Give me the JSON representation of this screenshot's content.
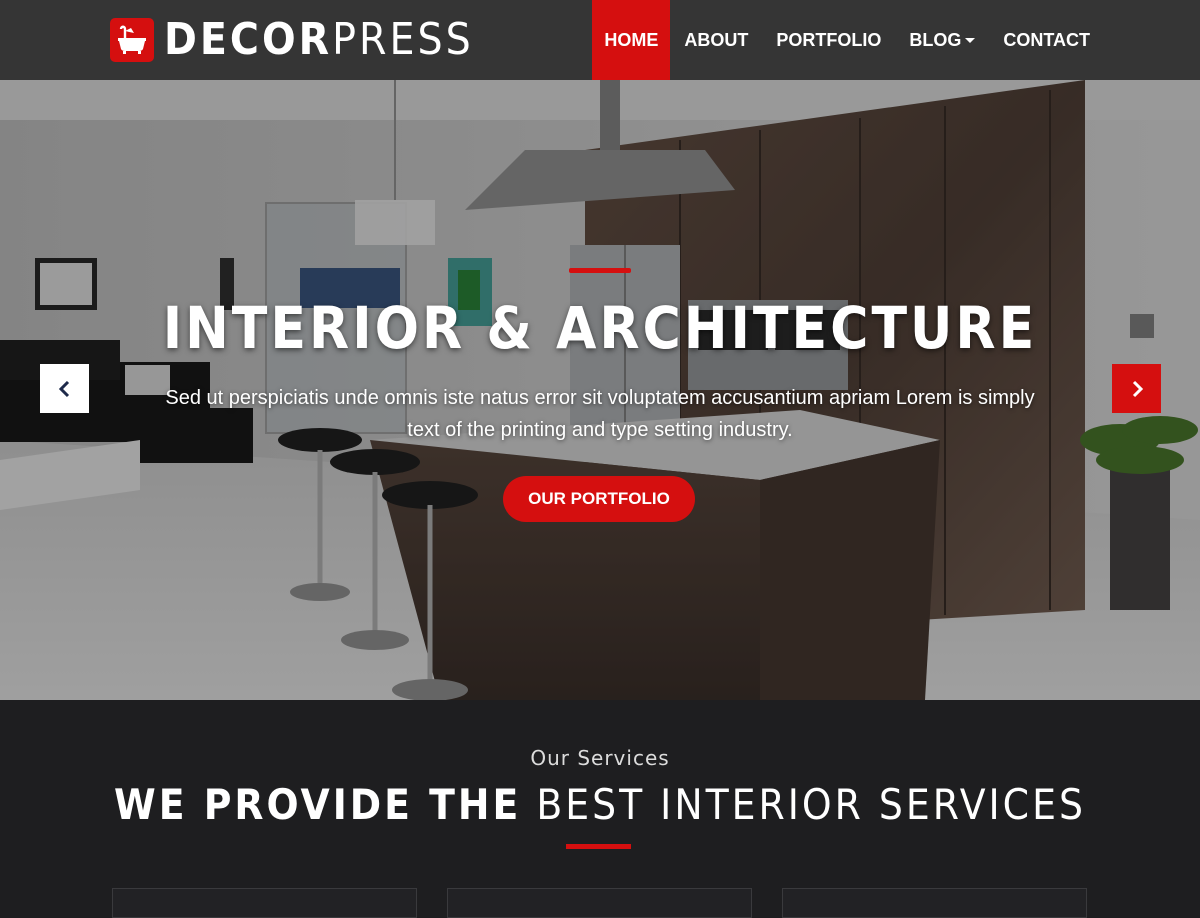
{
  "brand": {
    "name_bold": "DECOR",
    "name_light": "PRESS",
    "logo_icon": "bathtub-icon",
    "accent": "#d50f0f"
  },
  "nav": {
    "items": [
      {
        "label": "HOME",
        "active": true
      },
      {
        "label": "ABOUT"
      },
      {
        "label": "PORTFOLIO"
      },
      {
        "label": "BLOG",
        "has_dropdown": true
      },
      {
        "label": "CONTACT"
      }
    ]
  },
  "hero": {
    "title": "INTERIOR & ARCHITECTURE",
    "text": "Sed ut perspiciatis unde omnis iste natus error sit voluptatem accusantium apriam Lorem is simply text of the printing and type setting industry.",
    "button": "OUR PORTFOLIO",
    "prev_icon": "chevron-left-icon",
    "next_icon": "chevron-right-icon"
  },
  "services": {
    "subtitle": "Our Services",
    "title_bold": "WE PROVIDE THE",
    "title_light": "BEST INTERIOR SERVICES"
  }
}
